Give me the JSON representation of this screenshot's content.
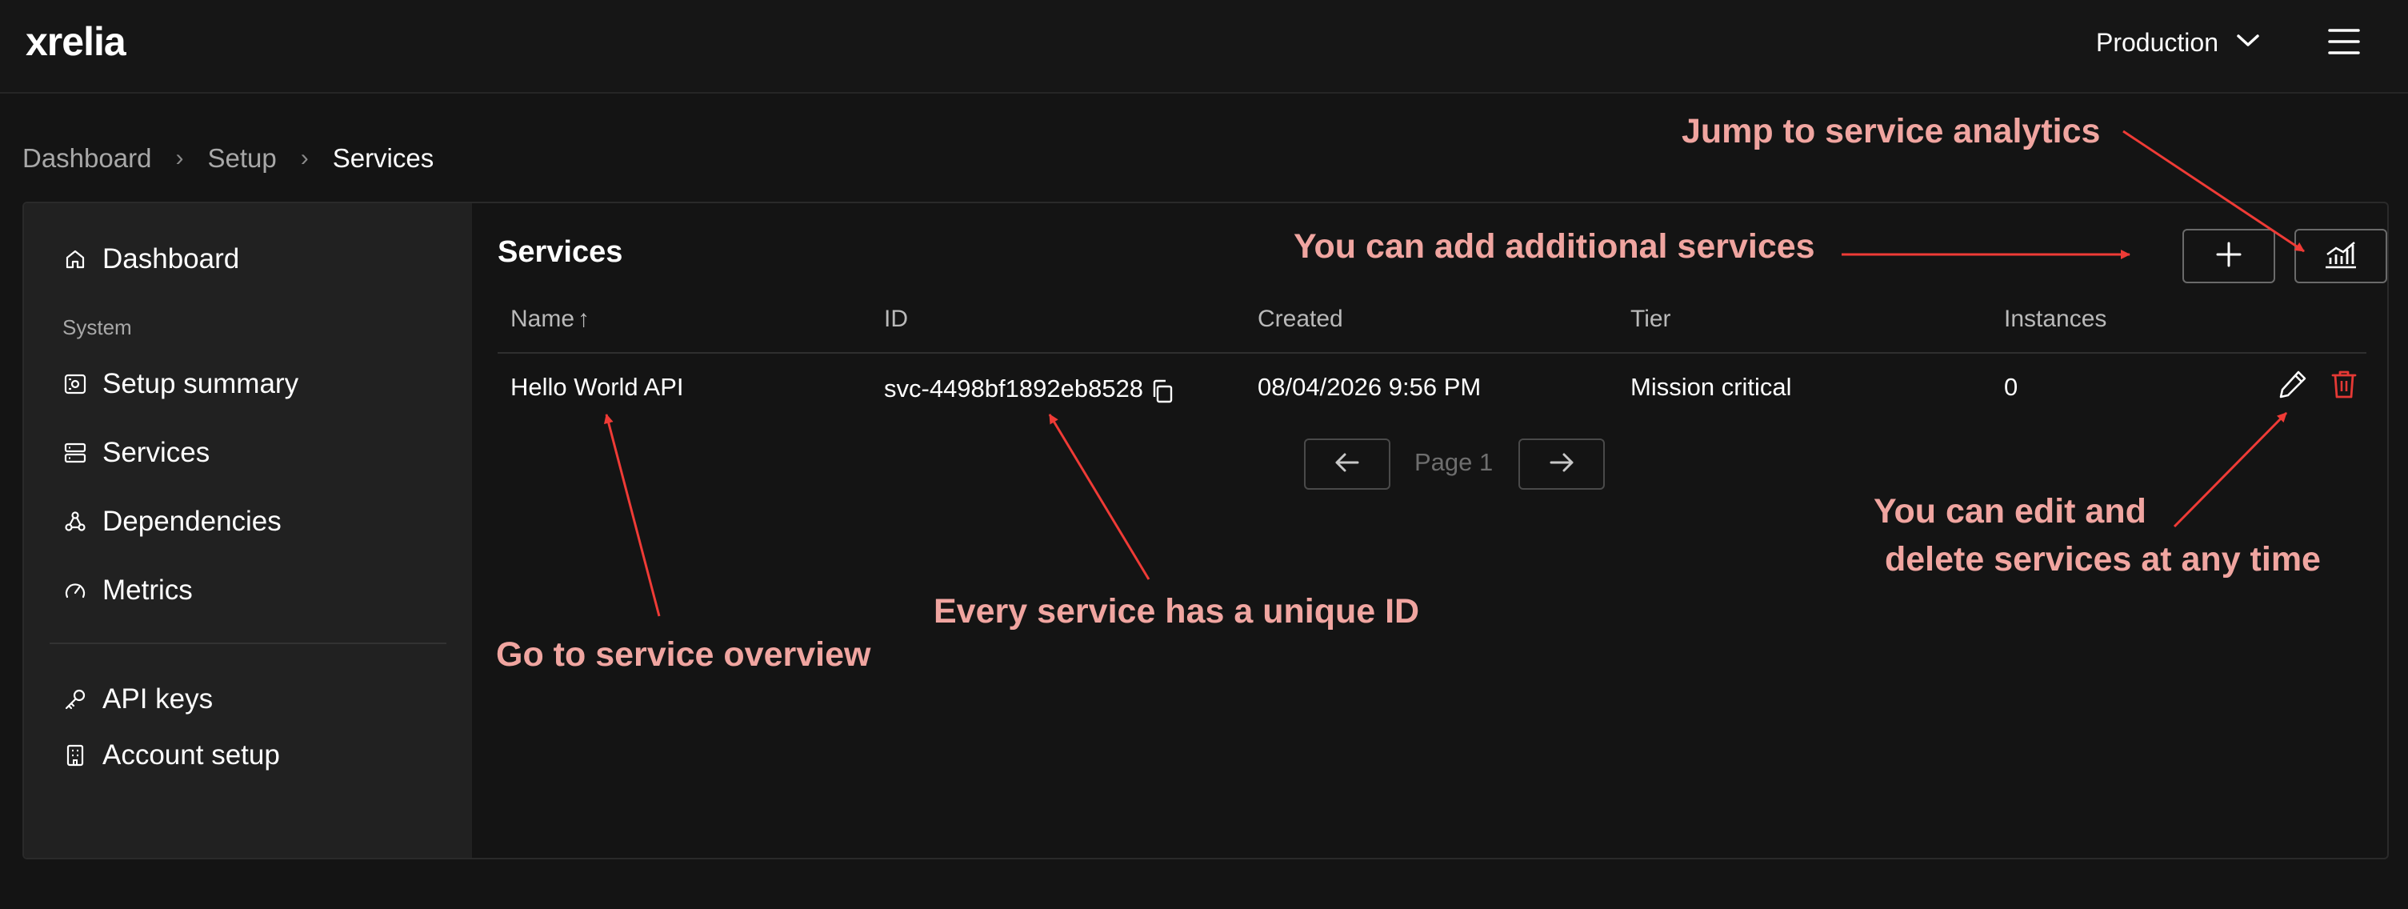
{
  "app": {
    "logo": "xrelia",
    "environment": "Production"
  },
  "breadcrumb": {
    "items": [
      "Dashboard",
      "Setup",
      "Services"
    ],
    "separator": "›"
  },
  "sidebar": {
    "dashboard": "Dashboard",
    "section_system": "System",
    "setup_summary": "Setup summary",
    "services": "Services",
    "dependencies": "Dependencies",
    "metrics": "Metrics",
    "api_keys": "API keys",
    "account_setup": "Account setup"
  },
  "main": {
    "title": "Services",
    "columns": {
      "name": "Name",
      "name_sort": "↑",
      "id": "ID",
      "created": "Created",
      "tier": "Tier",
      "instances": "Instances"
    },
    "rows": [
      {
        "name": "Hello World API",
        "id": "svc-4498bf1892eb8528",
        "created": "08/04/2026 9:56 PM",
        "tier": "Mission critical",
        "instances": "0"
      }
    ],
    "pagination": {
      "label": "Page 1"
    }
  },
  "annotations": {
    "analytics": "Jump to service analytics",
    "add": "You can add additional services",
    "overview": "Go to service overview",
    "unique_id": "Every service has a unique ID",
    "edit_line1": "You can edit and",
    "edit_line2": "delete services at any time"
  },
  "colors": {
    "background": "#141414",
    "sidebar": "#212121",
    "annotation_text": "#f0a5a0",
    "annotation_arrow": "#ef3b36",
    "delete": "#e53935"
  }
}
